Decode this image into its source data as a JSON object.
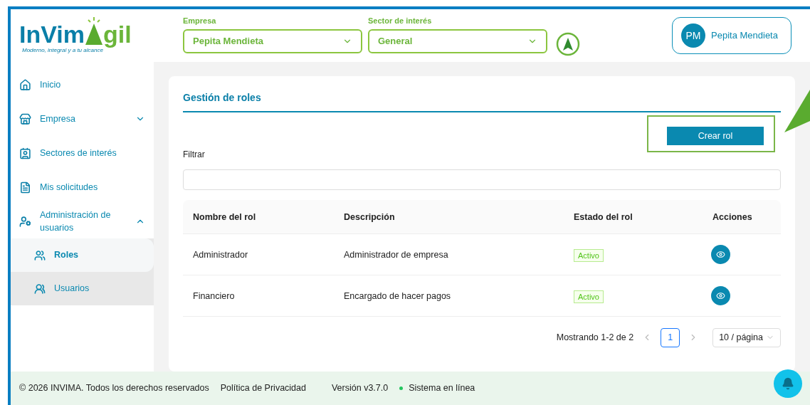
{
  "header": {
    "logo": {
      "word_start": "InVim",
      "word_end": "gil",
      "tagline": "Moderno, integral y a tu alcance"
    },
    "selects": [
      {
        "label": "Empresa",
        "value": "Pepita Mendieta"
      },
      {
        "label": "Sector de interés",
        "value": "General"
      }
    ],
    "user": {
      "initials": "PM",
      "name": "Pepita Mendieta"
    }
  },
  "sidebar": {
    "items": [
      {
        "kind": "home",
        "label": "Inicio"
      },
      {
        "kind": "store",
        "label": "Empresa",
        "expanded": false
      },
      {
        "kind": "sector",
        "label": "Sectores de interés"
      },
      {
        "kind": "file",
        "label": "Mis solicitudes"
      },
      {
        "kind": "admin",
        "label": "Administración de usuarios",
        "expanded": true,
        "children": [
          {
            "kind": "roles",
            "label": "Roles",
            "selected": true
          },
          {
            "kind": "users",
            "label": "Usuarios",
            "selected": false
          }
        ]
      }
    ]
  },
  "page": {
    "title": "Gestión de roles",
    "create_button": "Crear rol",
    "filter": {
      "label": "Filtrar"
    },
    "table": {
      "columns": [
        "Nombre del rol",
        "Descripción",
        "Estado del rol",
        "Acciones"
      ],
      "rows": [
        {
          "name": "Administrador",
          "description": "Administrador de empresa",
          "status": "Activo"
        },
        {
          "name": "Financiero",
          "description": "Encargado de hacer pagos",
          "status": "Activo"
        }
      ]
    },
    "pagination": {
      "summary": "Mostrando 1-2 de 2",
      "pages": [
        {
          "label": "1",
          "selected": true
        }
      ],
      "page_size": "10 / página"
    }
  },
  "footer": {
    "copyright": "© 2026 INVIMA. Todos los derechos reservados",
    "privacy": "Política de Privacidad",
    "version": "Versión v3.7.0",
    "status": "Sistema en línea",
    "online": true
  }
}
